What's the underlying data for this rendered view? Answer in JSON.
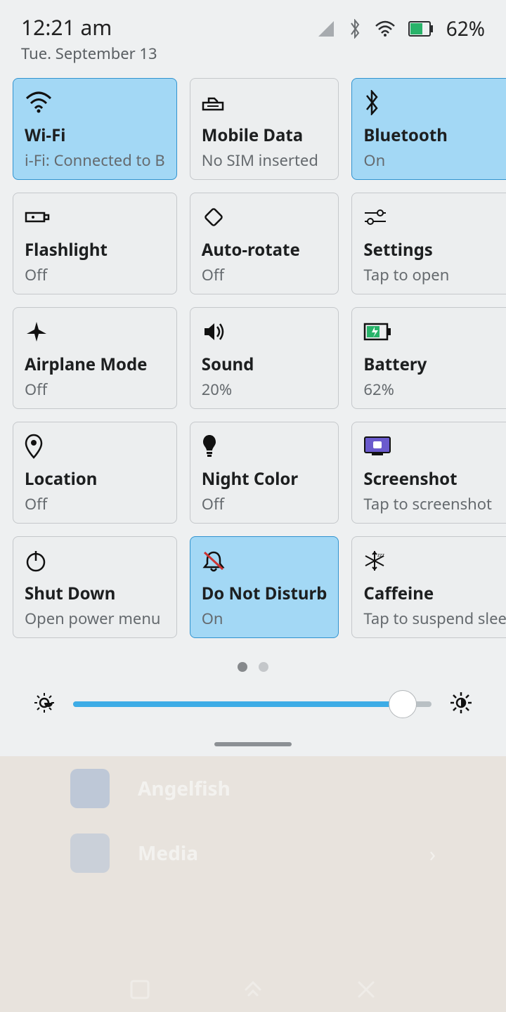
{
  "statusbar": {
    "time": "12:21 am",
    "date": "Tue. September 13",
    "battery_pct": "62%"
  },
  "tiles": {
    "wifi": {
      "title": "Wi-Fi",
      "sub": "i-Fi: Connected to B",
      "active": true
    },
    "mobile": {
      "title": "Mobile Data",
      "sub": "No SIM inserted",
      "active": false
    },
    "bluetooth": {
      "title": "Bluetooth",
      "sub": "On",
      "active": true
    },
    "flash": {
      "title": "Flashlight",
      "sub": "Off",
      "active": false
    },
    "rotate": {
      "title": "Auto-rotate",
      "sub": "Off",
      "active": false
    },
    "settings": {
      "title": "Settings",
      "sub": "Tap to open",
      "active": false
    },
    "airplane": {
      "title": "Airplane Mode",
      "sub": "Off",
      "active": false
    },
    "sound": {
      "title": "Sound",
      "sub": "20%",
      "active": false
    },
    "battery": {
      "title": "Battery",
      "sub": "62%",
      "active": false
    },
    "location": {
      "title": "Location",
      "sub": "Off",
      "active": false
    },
    "night": {
      "title": "Night Color",
      "sub": "Off",
      "active": false
    },
    "screenshot": {
      "title": "Screenshot",
      "sub": "Tap to screenshot",
      "active": false
    },
    "shutdown": {
      "title": "Shut Down",
      "sub": "Open power menu",
      "active": false
    },
    "dnd": {
      "title": "Do Not Disturb",
      "sub": "On",
      "active": true
    },
    "caffeine": {
      "title": "Caffeine",
      "sub": "Tap to suspend sleep",
      "active": false
    }
  },
  "pager": {
    "current": 0,
    "total": 2
  },
  "brightness": {
    "value_pct": 92
  },
  "background": {
    "app1": "Angelfish",
    "app2": "Media"
  }
}
